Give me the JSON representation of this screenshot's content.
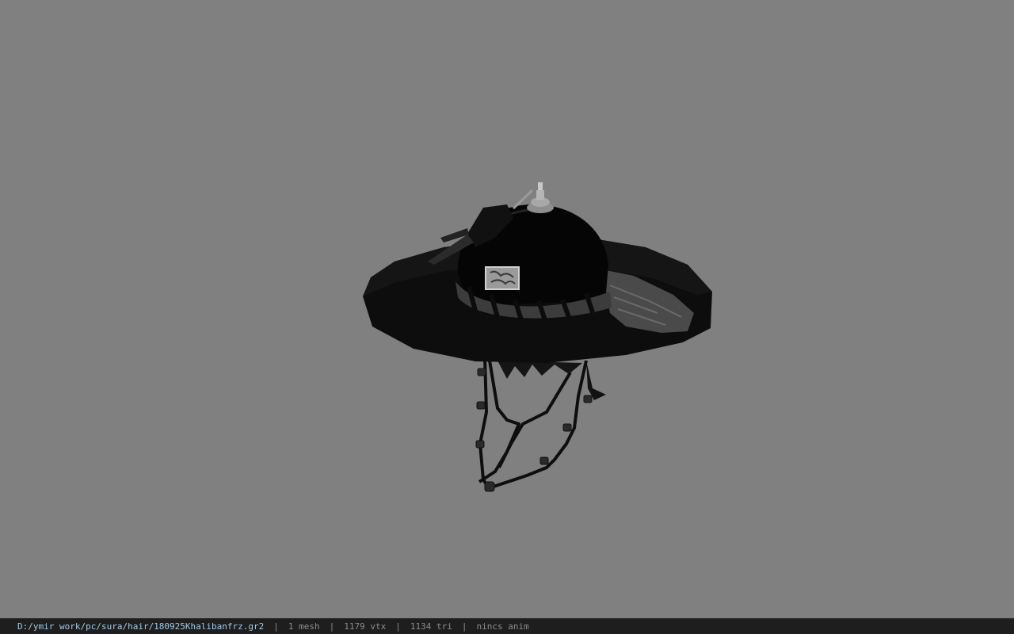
{
  "viewport": {
    "background_color": "#808080",
    "model": {
      "description_icon": "hat-3d-model"
    }
  },
  "status_bar": {
    "file_path": "D:/ymir work/pc/sura/hair/180925Khalibanfrz.gr2",
    "separator": "|",
    "mesh_count": "1 mesh",
    "vertex_count": "1179 vtx",
    "triangle_count": "1134 tri",
    "anim_status": "nincs anim"
  }
}
